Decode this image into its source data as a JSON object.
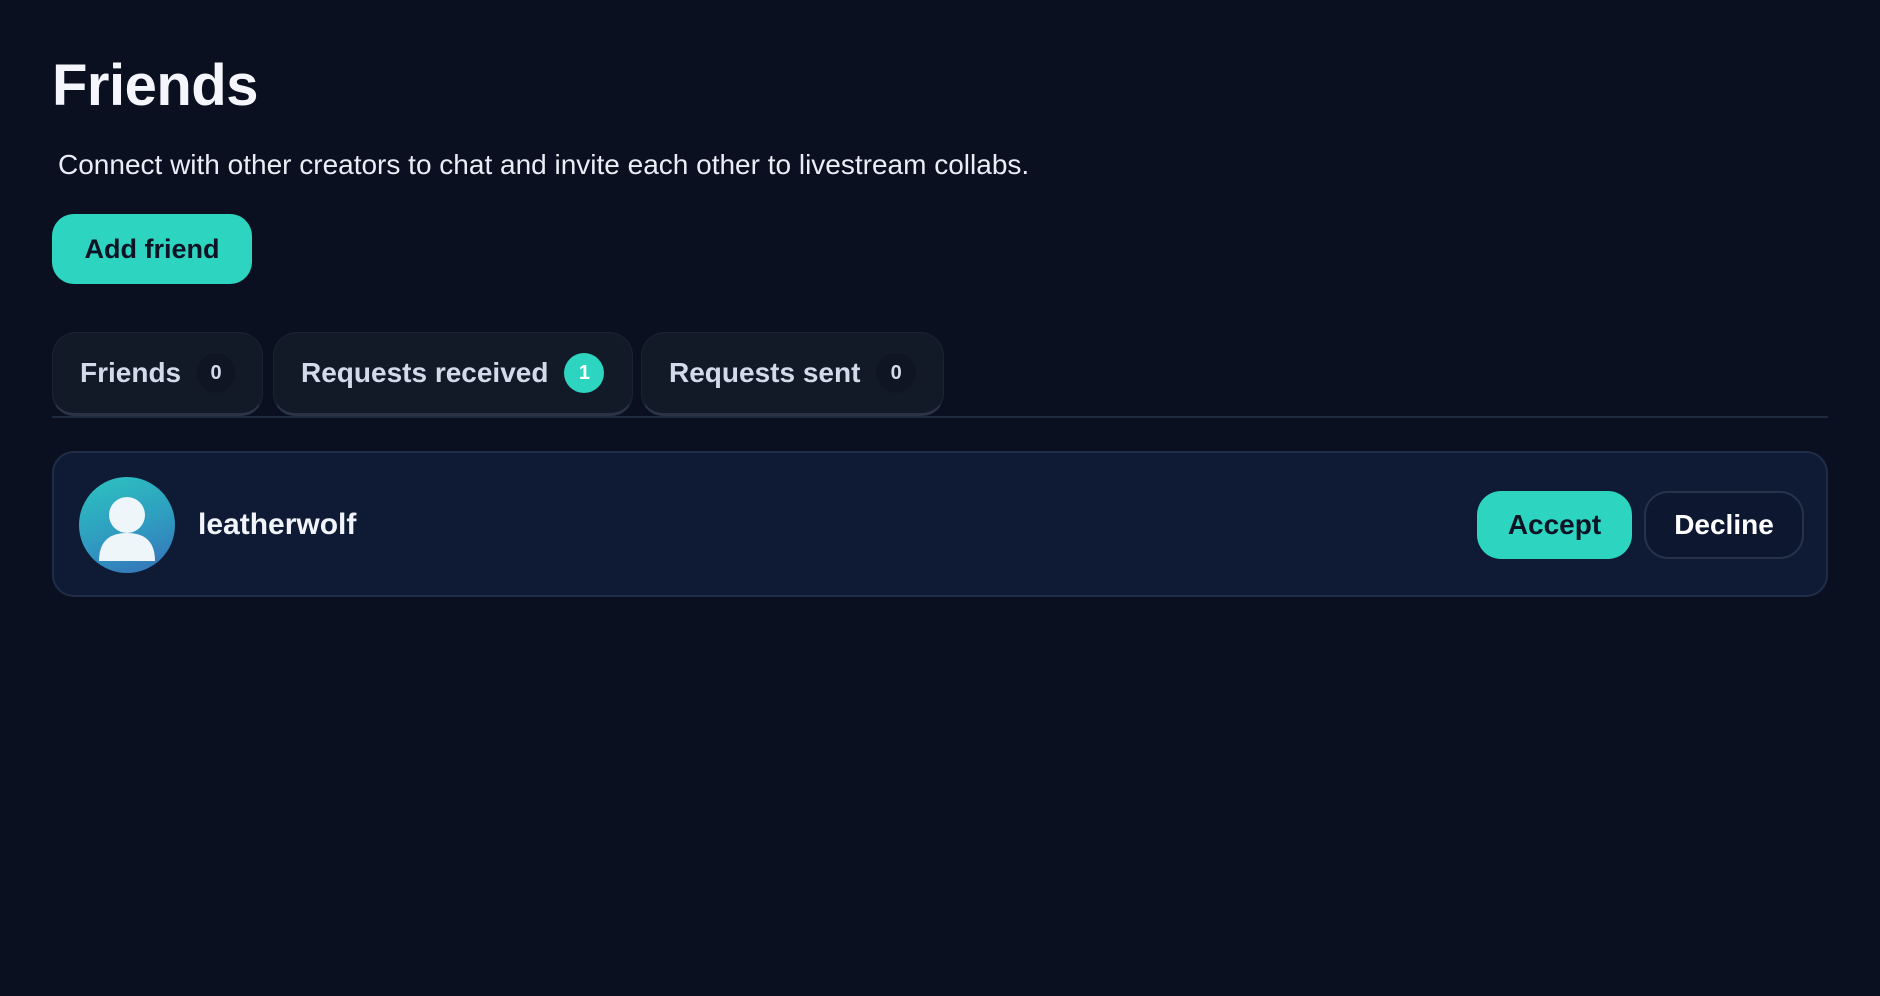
{
  "header": {
    "title": "Friends",
    "subtitle": "Connect with other creators to chat and invite each other to livestream collabs."
  },
  "actions": {
    "add_friend_label": "Add friend"
  },
  "tabs": [
    {
      "label": "Friends",
      "count": "0",
      "active": false
    },
    {
      "label": "Requests received",
      "count": "1",
      "active": true
    },
    {
      "label": "Requests sent",
      "count": "0",
      "active": false
    }
  ],
  "requests": [
    {
      "username": "leatherwolf",
      "avatar_icon": "user-silhouette-icon",
      "accept_label": "Accept",
      "decline_label": "Decline"
    }
  ],
  "colors": {
    "background": "#0a1020",
    "accent": "#2dd4bf",
    "card": "#0f1b35"
  }
}
